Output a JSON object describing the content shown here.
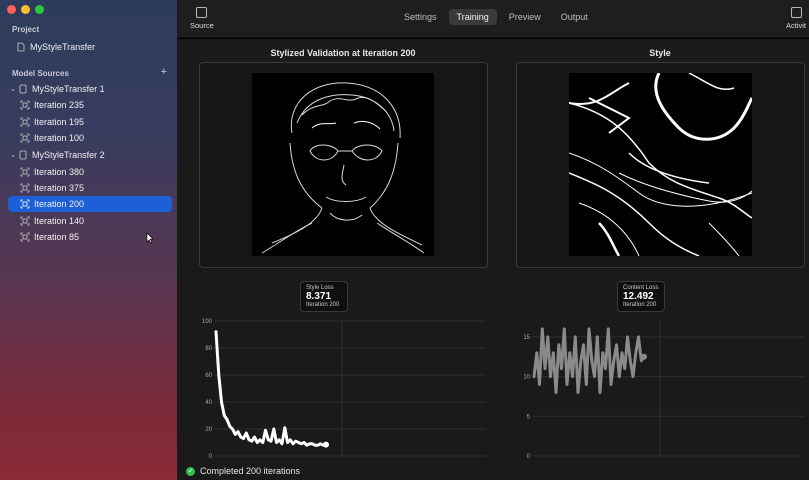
{
  "sidebar": {
    "project_label": "Project",
    "project_name": "MyStyleTransfer",
    "sources_label": "Model Sources",
    "add_symbol": "+",
    "groups": [
      {
        "name": "MyStyleTransfer 1",
        "items": [
          "Iteration 235",
          "Iteration 195",
          "Iteration 100"
        ]
      },
      {
        "name": "MyStyleTransfer 2",
        "items": [
          "Iteration 380",
          "Iteration 375",
          "Iteration 200",
          "Iteration 140",
          "Iteration 85"
        ]
      }
    ],
    "selected": "Iteration 200"
  },
  "toolbar": {
    "source_label": "Source",
    "activity_label": "Activit",
    "tabs": [
      "Settings",
      "Training",
      "Preview",
      "Output"
    ],
    "active_tab": "Training"
  },
  "main": {
    "validation_title": "Stylized Validation at Iteration 200",
    "style_title": "Style",
    "style_tooltip": {
      "label": "Style Loss",
      "value": "8.371",
      "iteration": "Iteration 200"
    },
    "content_tooltip": {
      "label": "Content Loss",
      "value": "12.492",
      "iteration": "Iteration 200"
    }
  },
  "status": {
    "text": "Completed 200 iterations",
    "color": "#33c04a"
  },
  "chart_data": [
    {
      "type": "line",
      "name": "Style Loss",
      "ylim": [
        0,
        100
      ],
      "yticks": [
        0,
        20,
        40,
        60,
        80,
        100
      ],
      "x": [
        0,
        5,
        10,
        15,
        20,
        25,
        30,
        35,
        40,
        45,
        50,
        55,
        60,
        65,
        70,
        75,
        80,
        85,
        90,
        95,
        100,
        105,
        110,
        115,
        120,
        125,
        130,
        135,
        140,
        145,
        150,
        155,
        160,
        165,
        170,
        175,
        180,
        185,
        190,
        195,
        200
      ],
      "y": [
        92,
        60,
        40,
        30,
        27,
        22,
        20,
        16,
        18,
        14,
        13,
        17,
        12,
        11,
        14,
        10,
        12,
        10,
        19,
        12,
        11,
        20,
        10,
        12,
        9,
        21,
        10,
        12,
        9,
        11,
        10,
        9,
        10,
        8,
        9,
        9,
        8,
        8,
        9,
        8,
        8.4
      ],
      "color": "#ffffff"
    },
    {
      "type": "line",
      "name": "Content Loss",
      "ylim": [
        0,
        17
      ],
      "yticks": [
        0,
        5,
        10,
        15
      ],
      "x": [
        0,
        5,
        10,
        15,
        20,
        25,
        30,
        35,
        40,
        45,
        50,
        55,
        60,
        65,
        70,
        75,
        80,
        85,
        90,
        95,
        100,
        105,
        110,
        115,
        120,
        125,
        130,
        135,
        140,
        145,
        150,
        155,
        160,
        165,
        170,
        175,
        180,
        185,
        190,
        195,
        200
      ],
      "y": [
        10,
        13,
        9,
        16,
        11,
        15,
        10,
        13,
        8,
        14,
        11,
        16,
        9,
        13,
        10,
        15,
        8,
        12,
        14,
        9,
        16,
        12,
        10,
        15,
        8,
        13,
        11,
        16,
        9,
        12,
        14,
        10,
        13,
        11,
        15,
        12,
        10,
        13,
        15,
        12,
        12.5
      ],
      "color": "#8a8a8a"
    }
  ]
}
